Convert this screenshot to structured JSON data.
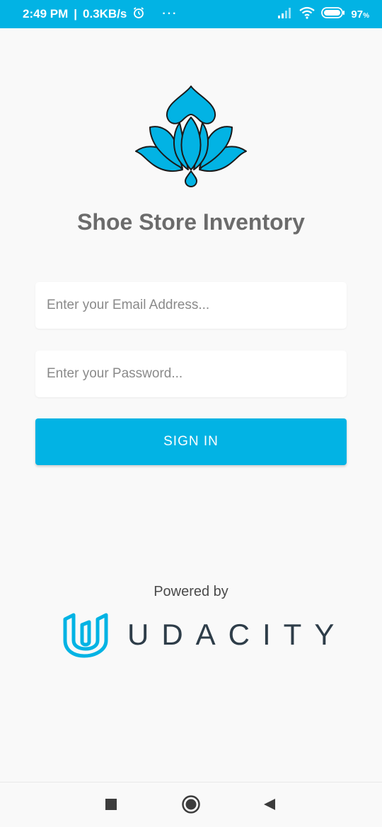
{
  "status_bar": {
    "time": "2:49 PM",
    "network_speed": "0.3KB/s",
    "more": "···",
    "battery_percent": "97",
    "battery_unit": "%"
  },
  "app": {
    "title": "Shoe Store Inventory",
    "logo_icon": "lotus-icon",
    "brand_color": "#02b3e4"
  },
  "login": {
    "email_placeholder": "Enter your Email Address...",
    "password_placeholder": "Enter your Password...",
    "sign_in_label": "SIGN IN"
  },
  "footer": {
    "powered_by": "Powered by",
    "brand_name": "UDACITY",
    "brand_icon": "udacity-u-icon"
  },
  "nav_bar": {
    "recent_icon": "square-icon",
    "home_icon": "circle-icon",
    "back_icon": "triangle-back-icon"
  }
}
